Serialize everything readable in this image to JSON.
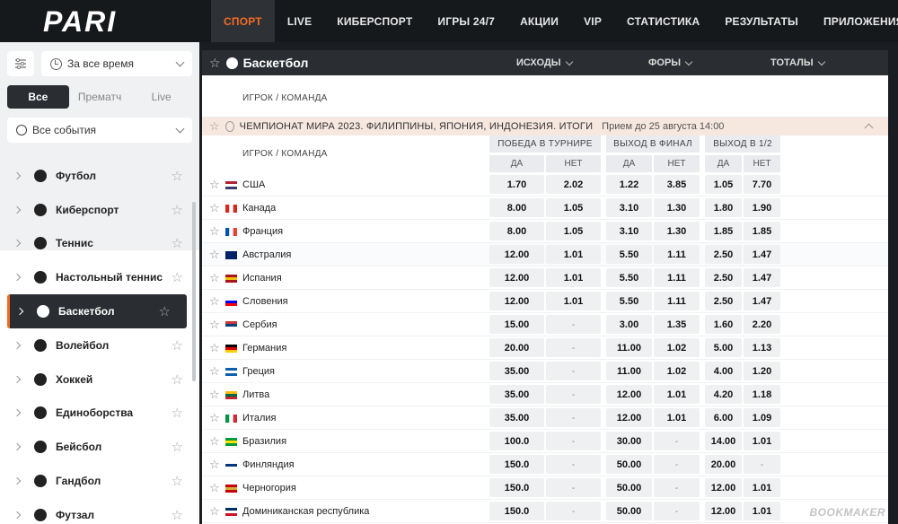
{
  "brand": {
    "logo_text": "PARI",
    "accent": "#f36a21"
  },
  "nav": [
    "СПОРТ",
    "LIVE",
    "КИБЕРСПОРТ",
    "ИГРЫ 24/7",
    "АКЦИИ",
    "VIP",
    "СТАТИСТИКА",
    "РЕЗУЛЬТАТЫ",
    "ПРИЛОЖЕНИЯ"
  ],
  "sidebar": {
    "time_filter": "За все время",
    "tabs": [
      "Все",
      "Прематч",
      "Live"
    ],
    "events_filter": "Все события",
    "sports": [
      {
        "label": "Футбол",
        "icon": "football-icon"
      },
      {
        "label": "Киберспорт",
        "icon": "gamepad-icon"
      },
      {
        "label": "Теннис",
        "icon": "tennis-icon"
      },
      {
        "label": "Настольный теннис",
        "icon": "table-tennis-icon"
      },
      {
        "label": "Баскетбол",
        "icon": "basketball-icon"
      },
      {
        "label": "Волейбол",
        "icon": "volleyball-icon"
      },
      {
        "label": "Хоккей",
        "icon": "hockey-icon"
      },
      {
        "label": "Единоборства",
        "icon": "fist-icon"
      },
      {
        "label": "Бейсбол",
        "icon": "baseball-icon"
      },
      {
        "label": "Гандбол",
        "icon": "handball-icon"
      },
      {
        "label": "Футзал",
        "icon": "futsal-icon"
      }
    ]
  },
  "main": {
    "sport_title": "Баскетбол",
    "columns": [
      "ИСХОДЫ",
      "ФОРЫ",
      "ТОТАЛЫ"
    ],
    "player_label": "ИГРОК / КОМАНДА",
    "championship": "ЧЕМПИОНАТ МИРА 2023. ФИЛИППИНЫ, ЯПОНИЯ, ИНДОНЕЗИЯ. ИТОГИ",
    "accept_until": "Прием до 25 августа 14:00",
    "groups": [
      "ПОБЕДА В ТУРНИРЕ",
      "ВЫХОД В ФИНАЛ",
      "ВЫХОД В 1/2"
    ],
    "yes_label": "ДА",
    "no_label": "НЕТ",
    "rows": [
      {
        "team": "США",
        "flag": "us",
        "odds": [
          "1.70",
          "2.02",
          "1.22",
          "3.85",
          "1.05",
          "7.70"
        ]
      },
      {
        "team": "Канада",
        "flag": "ca",
        "odds": [
          "8.00",
          "1.05",
          "3.10",
          "1.30",
          "1.80",
          "1.90"
        ]
      },
      {
        "team": "Франция",
        "flag": "fr",
        "odds": [
          "8.00",
          "1.05",
          "3.10",
          "1.30",
          "1.85",
          "1.85"
        ]
      },
      {
        "team": "Австралия",
        "flag": "au",
        "odds": [
          "12.00",
          "1.01",
          "5.50",
          "1.11",
          "2.50",
          "1.47"
        ]
      },
      {
        "team": "Испания",
        "flag": "es",
        "odds": [
          "12.00",
          "1.01",
          "5.50",
          "1.11",
          "2.50",
          "1.47"
        ]
      },
      {
        "team": "Словения",
        "flag": "si",
        "odds": [
          "12.00",
          "1.01",
          "5.50",
          "1.11",
          "2.50",
          "1.47"
        ]
      },
      {
        "team": "Сербия",
        "flag": "rs",
        "odds": [
          "15.00",
          "-",
          "3.00",
          "1.35",
          "1.60",
          "2.20"
        ]
      },
      {
        "team": "Германия",
        "flag": "de",
        "odds": [
          "20.00",
          "-",
          "11.00",
          "1.02",
          "5.00",
          "1.13"
        ]
      },
      {
        "team": "Греция",
        "flag": "gr",
        "odds": [
          "35.00",
          "-",
          "11.00",
          "1.02",
          "4.00",
          "1.20"
        ]
      },
      {
        "team": "Литва",
        "flag": "lt",
        "odds": [
          "35.00",
          "-",
          "12.00",
          "1.01",
          "4.20",
          "1.18"
        ]
      },
      {
        "team": "Италия",
        "flag": "it",
        "odds": [
          "35.00",
          "-",
          "12.00",
          "1.01",
          "6.00",
          "1.09"
        ]
      },
      {
        "team": "Бразилия",
        "flag": "br",
        "odds": [
          "100.0",
          "-",
          "30.00",
          "-",
          "14.00",
          "1.01"
        ]
      },
      {
        "team": "Финляндия",
        "flag": "fi",
        "odds": [
          "150.0",
          "-",
          "50.00",
          "-",
          "20.00",
          "-"
        ]
      },
      {
        "team": "Черногория",
        "flag": "me",
        "odds": [
          "150.0",
          "-",
          "50.00",
          "-",
          "12.00",
          "1.01"
        ]
      },
      {
        "team": "Доминиканская республика",
        "flag": "do",
        "odds": [
          "150.0",
          "-",
          "50.00",
          "-",
          "12.00",
          "1.01"
        ]
      }
    ]
  },
  "watermark": "BOOKMAKER"
}
